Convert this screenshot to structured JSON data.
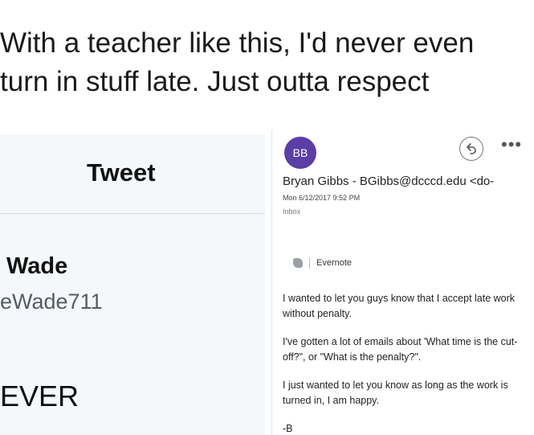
{
  "caption": {
    "line1": "With a teacher like this, I'd never even",
    "line2": "turn in stuff late. Just outta respect"
  },
  "tweet": {
    "title": "Tweet",
    "name": "Wade",
    "handle": "eWade711",
    "body": "EVER"
  },
  "email": {
    "avatar_initials": "BB",
    "avatar_color": "#5b3ea6",
    "reply_icon": "reply-icon",
    "more_icon": "more-icon",
    "sender": "Bryan Gibbs - BGibbs@dcccd.edu <do-",
    "datetime": "Mon 6/12/2017 9:52 PM",
    "folder": "Inbox",
    "evernote_label": "Evernote",
    "paragraphs": [
      "I wanted to let you guys know that I accept late work without penalty.",
      "I've gotten a lot of emails about 'What time is the cut-off?\", or \"What is the penalty?\".",
      "I just wanted to let you know as long as the work is turned in, I am happy."
    ],
    "signature": "-B"
  }
}
